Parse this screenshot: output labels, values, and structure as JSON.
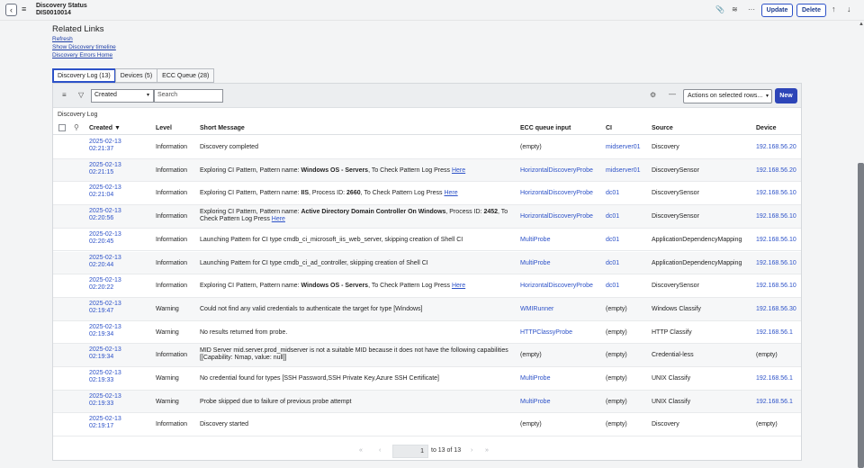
{
  "header": {
    "title": "Discovery Status",
    "number": "DIS0010014",
    "update_label": "Update",
    "delete_label": "Delete"
  },
  "related_links": {
    "title": "Related Links",
    "links": [
      "Refresh",
      "Show Discovery timeline",
      "Discovery Errors Home"
    ]
  },
  "tabs": [
    {
      "label": "Discovery Log (13)",
      "active": true
    },
    {
      "label": "Devices (5)",
      "active": false
    },
    {
      "label": "ECC Queue (28)",
      "active": false
    }
  ],
  "toolbar": {
    "field_select": "Created",
    "search_placeholder": "Search",
    "actions_label": "Actions on selected rows...",
    "new_label": "New"
  },
  "list_label": "Discovery Log",
  "columns": [
    "Created ▼",
    "Level",
    "Short Message",
    "ECC queue input",
    "CI",
    "Source",
    "Device"
  ],
  "rows": [
    {
      "date": "2025-02-13",
      "time": "02:21:37",
      "level": "Information",
      "msg_parts": [
        "Discovery completed"
      ],
      "ecc": "(empty)",
      "ecc_link": false,
      "ci": "midserver01",
      "ci_link": true,
      "source": "Discovery",
      "device": "192.168.56.20",
      "device_link": true
    },
    {
      "date": "2025-02-13",
      "time": "02:21:15",
      "level": "Information",
      "msg_parts": [
        "Exploring CI Pattern, Pattern name: ",
        "Windows OS - Servers",
        ", To Check Pattern Log Press ",
        "Here"
      ],
      "ecc": "HorizontalDiscoveryProbe",
      "ecc_link": true,
      "ci": "midserver01",
      "ci_link": true,
      "source": "DiscoverySensor",
      "device": "192.168.56.20",
      "device_link": true
    },
    {
      "date": "2025-02-13",
      "time": "02:21:04",
      "level": "Information",
      "msg_parts": [
        "Exploring CI Pattern, Pattern name: ",
        "IIS",
        ", Process ID: ",
        "2660",
        ", To Check Pattern Log Press ",
        "Here"
      ],
      "ecc": "HorizontalDiscoveryProbe",
      "ecc_link": true,
      "ci": "dc01",
      "ci_link": true,
      "source": "DiscoverySensor",
      "device": "192.168.56.10",
      "device_link": true
    },
    {
      "date": "2025-02-13",
      "time": "02:20:56",
      "level": "Information",
      "msg_parts": [
        "Exploring CI Pattern, Pattern name: ",
        "Active Directory Domain Controller On Windows",
        ", Process ID: ",
        "2452",
        ", To Check Pattern Log Press ",
        "Here"
      ],
      "ecc": "HorizontalDiscoveryProbe",
      "ecc_link": true,
      "ci": "dc01",
      "ci_link": true,
      "source": "DiscoverySensor",
      "device": "192.168.56.10",
      "device_link": true
    },
    {
      "date": "2025-02-13",
      "time": "02:20:45",
      "level": "Information",
      "msg_parts": [
        "Launching Pattern for CI type cmdb_ci_microsoft_iis_web_server, skipping creation of Shell CI"
      ],
      "ecc": "MultiProbe",
      "ecc_link": true,
      "ci": "dc01",
      "ci_link": true,
      "source": "ApplicationDependencyMapping",
      "device": "192.168.56.10",
      "device_link": true
    },
    {
      "date": "2025-02-13",
      "time": "02:20:44",
      "level": "Information",
      "msg_parts": [
        "Launching Pattern for CI type cmdb_ci_ad_controller, skipping creation of Shell CI"
      ],
      "ecc": "MultiProbe",
      "ecc_link": true,
      "ci": "dc01",
      "ci_link": true,
      "source": "ApplicationDependencyMapping",
      "device": "192.168.56.10",
      "device_link": true
    },
    {
      "date": "2025-02-13",
      "time": "02:20:22",
      "level": "Information",
      "msg_parts": [
        "Exploring CI Pattern, Pattern name: ",
        "Windows OS - Servers",
        ", To Check Pattern Log Press ",
        "Here"
      ],
      "ecc": "HorizontalDiscoveryProbe",
      "ecc_link": true,
      "ci": "dc01",
      "ci_link": true,
      "source": "DiscoverySensor",
      "device": "192.168.56.10",
      "device_link": true
    },
    {
      "date": "2025-02-13",
      "time": "02:19:47",
      "level": "Warning",
      "msg_parts": [
        "Could not find any valid credentials to authenticate the target for type [Windows]"
      ],
      "ecc": "WMIRunner",
      "ecc_link": true,
      "ci": "(empty)",
      "ci_link": false,
      "source": "Windows Classify",
      "device": "192.168.56.30",
      "device_link": true
    },
    {
      "date": "2025-02-13",
      "time": "02:19:34",
      "level": "Warning",
      "msg_parts": [
        "No results returned from probe."
      ],
      "ecc": "HTTPClassyProbe",
      "ecc_link": true,
      "ci": "(empty)",
      "ci_link": false,
      "source": "HTTP Classify",
      "device": "192.168.56.1",
      "device_link": true
    },
    {
      "date": "2025-02-13",
      "time": "02:19:34",
      "level": "Information",
      "msg_parts": [
        "MID Server mid.server.prod_midserver is not a suitable MID because it does not have the following capabilities [[Capability: Nmap, value: null]]"
      ],
      "ecc": "(empty)",
      "ecc_link": false,
      "ci": "(empty)",
      "ci_link": false,
      "source": "Credential-less",
      "device": "(empty)",
      "device_link": false
    },
    {
      "date": "2025-02-13",
      "time": "02:19:33",
      "level": "Warning",
      "msg_parts": [
        "No credential found for types [SSH Password,SSH Private Key,Azure SSH Certificate]"
      ],
      "ecc": "MultiProbe",
      "ecc_link": true,
      "ci": "(empty)",
      "ci_link": false,
      "source": "UNIX Classify",
      "device": "192.168.56.1",
      "device_link": true
    },
    {
      "date": "2025-02-13",
      "time": "02:19:33",
      "level": "Warning",
      "msg_parts": [
        "Probe skipped due to failure of previous probe attempt"
      ],
      "ecc": "MultiProbe",
      "ecc_link": true,
      "ci": "(empty)",
      "ci_link": false,
      "source": "UNIX Classify",
      "device": "192.168.56.1",
      "device_link": true
    },
    {
      "date": "2025-02-13",
      "time": "02:19:17",
      "level": "Information",
      "msg_parts": [
        "Discovery started"
      ],
      "ecc": "(empty)",
      "ecc_link": false,
      "ci": "(empty)",
      "ci_link": false,
      "source": "Discovery",
      "device": "(empty)",
      "device_link": false
    }
  ],
  "pager": {
    "page": "1",
    "text": "to 13 of 13"
  },
  "icons": [
    "back-icon",
    "menu-icon",
    "attachment-icon",
    "settings-sliders-icon",
    "more-icon",
    "arrow-up-icon",
    "arrow-down-icon",
    "hamburger-icon",
    "filter-icon",
    "gear-icon",
    "minus-icon",
    "search-icon"
  ],
  "colors": {
    "accent": "#2d52c8",
    "new_button": "#2d45b8",
    "header_bg": "#f3f4f5"
  }
}
